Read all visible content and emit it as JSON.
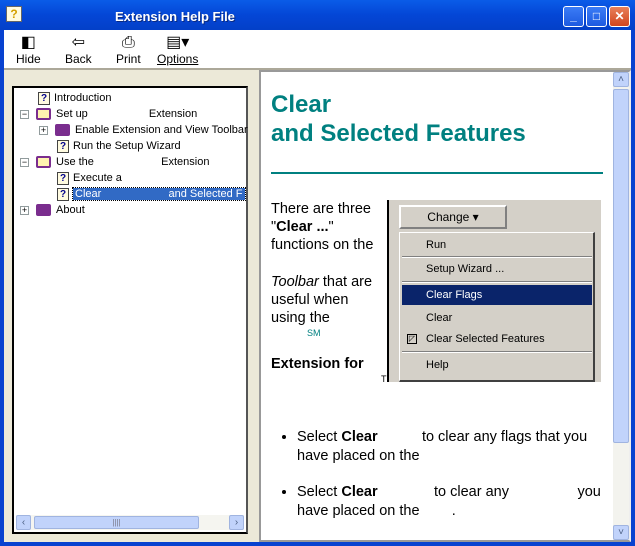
{
  "window": {
    "title": "Extension Help File",
    "icon": "help-file-icon",
    "minimize": "_",
    "maximize": "□",
    "close": "✕"
  },
  "toolbar": {
    "hide": "Hide",
    "back": "Back",
    "print": "Print",
    "options": "Options"
  },
  "tree": {
    "items": [
      {
        "label": "Introduction",
        "icon": "help-page-icon"
      },
      {
        "label": "Set up                    Extension",
        "icon": "book-open-icon",
        "expander": "−"
      },
      {
        "label": "Enable Extension and View Toolbar",
        "icon": "book-closed-icon",
        "expander": "+"
      },
      {
        "label": "Run the Setup Wizard",
        "icon": "help-page-icon"
      },
      {
        "label": "Use the                      Extension",
        "icon": "book-open-icon",
        "expander": "−"
      },
      {
        "label": "Execute a",
        "icon": "help-page-icon"
      },
      {
        "label": "Clear                      and Selected F",
        "icon": "help-page-icon",
        "selected": true
      },
      {
        "label": "About",
        "icon": "book-closed-icon",
        "expander": "+"
      }
    ]
  },
  "content": {
    "heading_line1": "Clear",
    "heading_line2": "and Selected Features",
    "para": {
      "l1": "There are three",
      "l2_pre": "\"",
      "l2_bold": "Clear ...",
      "l2_post": "\"",
      "l3": "functions on the",
      "l4_italic": "Toolbar",
      "l4_post": " that are",
      "l5": "useful when",
      "l6": "using the",
      "sm": "SM",
      "ext": "Extension for",
      "tm": "TM"
    },
    "menu": {
      "button": "Change",
      "items": [
        "Run",
        "Setup Wizard ...",
        "Clear Flags",
        "Clear",
        "Clear Selected Features",
        "Help"
      ],
      "highlighted": "Clear Flags"
    },
    "bullets": [
      {
        "pre": "Select ",
        "bold": "Clear",
        "post": "           to clear any flags that you have placed on the"
      },
      {
        "pre": "Select ",
        "bold": "Clear",
        "post": "              to clear any                 you have placed on the        ."
      }
    ]
  },
  "colors": {
    "heading": "#008080",
    "selection": "#316ac5",
    "menu_highlight": "#0a246a"
  }
}
